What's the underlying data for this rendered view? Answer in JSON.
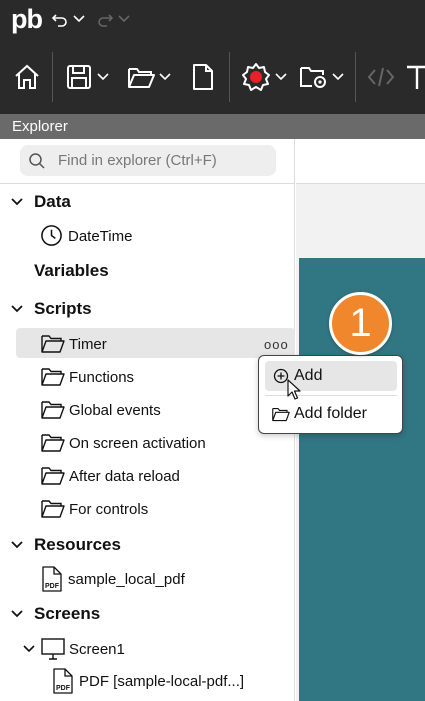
{
  "app": {
    "logo_text": "pb"
  },
  "explorer": {
    "header": "Explorer",
    "search_placeholder": "Find in explorer (Ctrl+F)",
    "sections": {
      "data": "Data",
      "variables": "Variables",
      "scripts": "Scripts",
      "resources": "Resources",
      "screens": "Screens"
    },
    "data_items": [
      "DateTime"
    ],
    "script_folders": [
      "Timer",
      "Functions",
      "Global events",
      "On screen activation",
      "After data reload",
      "For controls"
    ],
    "resource_items": [
      "sample_local_pdf"
    ],
    "screen_items": [
      "Screen1"
    ],
    "screen_children": [
      "PDF [sample-local-pdf...]"
    ],
    "more_label": "ooo"
  },
  "context_menu": {
    "items": [
      "Add",
      "Add folder"
    ]
  },
  "callout": {
    "number": "1",
    "color": "#f0872d"
  },
  "colors": {
    "canvas": "#317683",
    "titlebar": "#2a2a2a",
    "recording": "#e8202a"
  }
}
